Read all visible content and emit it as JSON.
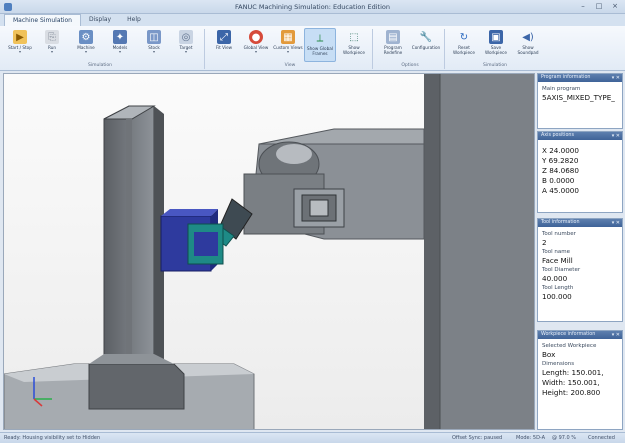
{
  "window": {
    "title": "FANUC Machining Simulation: Education Edition",
    "controls": [
      "–",
      "□",
      "×"
    ]
  },
  "tabs": [
    {
      "label": "Machine Simulation",
      "active": true
    },
    {
      "label": "Display",
      "active": false
    },
    {
      "label": "Help",
      "active": false
    }
  ],
  "ribbon": {
    "buttons": [
      {
        "label": "Start / Stop",
        "icon": "start-icon",
        "arrow": "▾"
      },
      {
        "label": "Run",
        "icon": "run-icon",
        "arrow": "▾"
      },
      {
        "label": "Machine",
        "icon": "machine-icon",
        "arrow": "▾"
      },
      {
        "label": "Models",
        "icon": "models-icon",
        "arrow": "▾"
      },
      {
        "label": "Stock",
        "icon": "stock-icon",
        "arrow": "▾"
      },
      {
        "label": "Target",
        "icon": "target-icon",
        "arrow": "▾"
      },
      {
        "label": "Fit View",
        "icon": "fit-view-icon",
        "arrow": ""
      },
      {
        "label": "Global View",
        "icon": "global-view-icon",
        "arrow": "▾"
      },
      {
        "label": "Custom Views",
        "icon": "custom-views-icon",
        "arrow": "▾"
      },
      {
        "label": "Show Global Frames",
        "icon": "global-frames-icon",
        "arrow": ""
      },
      {
        "label": "Show Workpiece",
        "icon": "workpiece-icon",
        "arrow": ""
      },
      {
        "label": "Program Redefine",
        "icon": "program-icon",
        "arrow": ""
      },
      {
        "label": "Configuration",
        "icon": "wrench-icon",
        "arrow": ""
      },
      {
        "label": "Reset Workpiece",
        "icon": "reset-icon",
        "arrow": ""
      },
      {
        "label": "Save Workpiece",
        "icon": "save-icon",
        "arrow": ""
      },
      {
        "label": "Show Soundpad",
        "icon": "soundpad-icon",
        "arrow": ""
      }
    ],
    "groups": [
      "Simulation",
      "View",
      "Options",
      "Simulation"
    ]
  },
  "panels": {
    "program": {
      "header": "Program information",
      "label": "Main program",
      "value": "5AXIS_MIXED_TYPE_"
    },
    "axis": {
      "header": "Axis positions",
      "x": "X 24.0000",
      "y": "Y 69.2820",
      "z": "Z 84.0680",
      "b": "B 0.0000",
      "a": "A 45.0000"
    },
    "tool": {
      "header": "Tool information",
      "number_label": "Tool number",
      "number": "2",
      "name_label": "Tool name",
      "name": "Face Mill",
      "diameter_label": "Tool Diameter",
      "diameter": "40.000",
      "length_label": "Tool Length",
      "length": "100.000"
    },
    "workpiece": {
      "header": "Workpiece information",
      "selected_label": "Selected Workpiece",
      "selected": "Box",
      "dims_label": "Dimensions",
      "length": "Length: 150.001,",
      "width": "Width: 150.001,",
      "height": "Height: 200.800"
    }
  },
  "panel_controls": "▾ ✕",
  "statusbar": {
    "left": "Ready: Housing visibility set to Hidden",
    "mid": "Offset Sync: paused",
    "mode": "Mode: 5D-A",
    "speed": "@ 97.0 %",
    "right": "Connected"
  },
  "colors": {
    "accent": "#3f6398",
    "workpiece": "#2e3a9e",
    "tool": "#1e8a86",
    "machine": "#8d9296"
  }
}
